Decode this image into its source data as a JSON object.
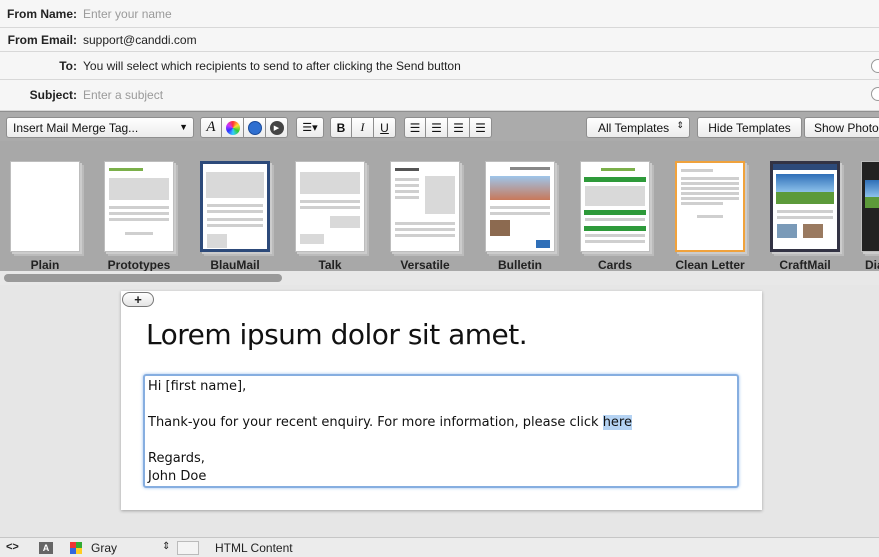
{
  "fields": {
    "from_name": {
      "label": "From Name:",
      "placeholder": "Enter your name"
    },
    "from_email": {
      "label": "From Email:",
      "value": "support@canddi.com"
    },
    "to": {
      "label": "To:",
      "value": "You will select which recipients to send to after clicking the Send button"
    },
    "subject": {
      "label": "Subject:",
      "placeholder": "Enter a subject"
    }
  },
  "toolbar": {
    "merge_tag": "Insert Mail Merge Tag...",
    "font_glyph": "A",
    "bold": "B",
    "italic": "I",
    "underline": "U",
    "templates_select": "All Templates",
    "hide_templates": "Hide Templates",
    "show_photos": "Show Photos"
  },
  "templates": [
    {
      "name": "Plain"
    },
    {
      "name": "Prototypes"
    },
    {
      "name": "BlauMail"
    },
    {
      "name": "Talk"
    },
    {
      "name": "Versatile"
    },
    {
      "name": "Bulletin"
    },
    {
      "name": "Cards"
    },
    {
      "name": "Clean Letter"
    },
    {
      "name": "CraftMail"
    },
    {
      "name": "Dia"
    }
  ],
  "editor": {
    "add_label": "+",
    "headline": "Lorem ipsum dolor sit amet.",
    "greeting": "Hi [first name],",
    "body_text": "Thank-you for your recent enquiry. For more information, please click ",
    "link_text": "here",
    "regards": "Regards,",
    "signature": "John Doe"
  },
  "bottom": {
    "code_glyph": "<>",
    "font_glyph": "A",
    "color": "Gray",
    "content_type": "HTML Content"
  },
  "colors": {
    "selected_template": "#f0a23c",
    "edit_focus": "#86aee0",
    "link_highlight": "#b5d3f3"
  }
}
